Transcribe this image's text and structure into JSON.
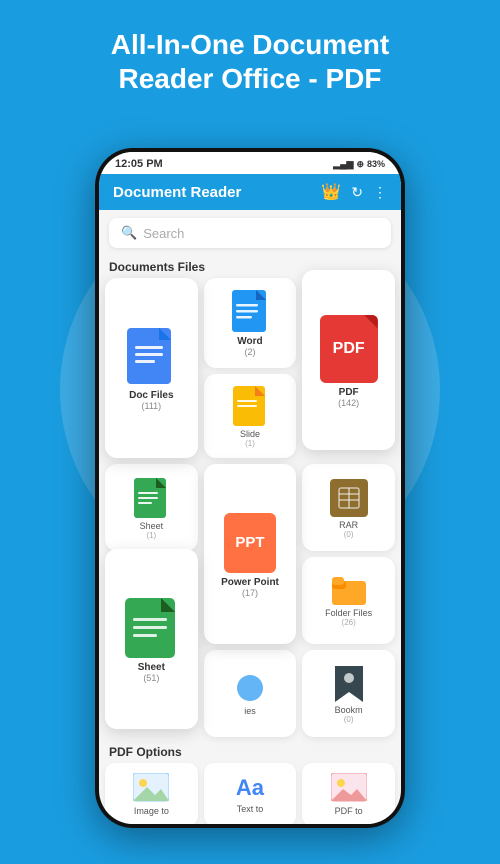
{
  "header": {
    "title": "All-In-One Document\nReader Office - PDF"
  },
  "status_bar": {
    "time": "12:05 PM",
    "battery": "83%",
    "signal": "▂▄▆█"
  },
  "app_bar": {
    "title": "Document Reader",
    "crown_icon": "👑",
    "refresh_icon": "↻",
    "more_icon": "⋮"
  },
  "search": {
    "placeholder": "Search"
  },
  "sections": {
    "documents_files": "Documents Files",
    "pdf_options": "PDF Options"
  },
  "file_cards": [
    {
      "id": "doc",
      "label": "Doc Files",
      "count": "(111)",
      "size": "large"
    },
    {
      "id": "word",
      "label": "Word",
      "count": "(2)",
      "size": "small"
    },
    {
      "id": "pdf",
      "label": "PDF",
      "count": "(142)",
      "size": "large"
    },
    {
      "id": "slide",
      "label": "Slide",
      "count": "(1)",
      "size": "small"
    },
    {
      "id": "sheet-small",
      "label": "Sheet",
      "count": "(1)",
      "size": "small"
    },
    {
      "id": "ppt",
      "label": "Power Point",
      "count": "(17)",
      "size": "large"
    },
    {
      "id": "rar",
      "label": "RAR",
      "count": "(0)",
      "size": "small"
    },
    {
      "id": "sheet-right",
      "label": "Sheet",
      "count": "(51)",
      "size": "large"
    },
    {
      "id": "folder",
      "label": "Folder Files",
      "count": "(26)",
      "size": "small"
    },
    {
      "id": "ies",
      "label": "ies",
      "count": "",
      "size": "small"
    },
    {
      "id": "bookmark",
      "label": "Bookm",
      "count": "(0)",
      "size": "small"
    }
  ],
  "option_cards": [
    {
      "id": "image-to",
      "label": "Image to"
    },
    {
      "id": "text-to",
      "label": "Text to"
    },
    {
      "id": "pdf-to",
      "label": "PDF to"
    }
  ],
  "colors": {
    "blue": "#1a9de0",
    "doc_blue": "#4285f4",
    "pdf_red": "#e53935",
    "ppt_orange": "#ff7043",
    "sheet_green": "#34a853",
    "slide_yellow": "#fbbc05",
    "rar_brown": "#8d6e2e",
    "bookmark_dark": "#37474f"
  }
}
